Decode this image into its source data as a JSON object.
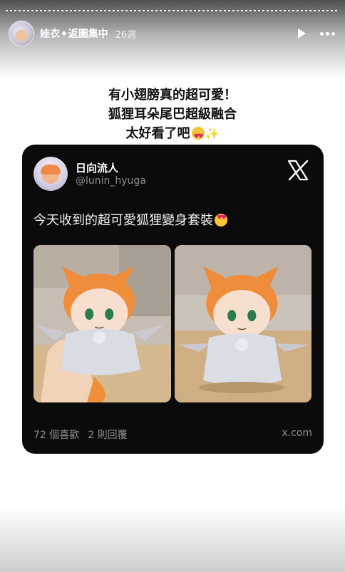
{
  "story": {
    "account_name": "娃衣✦返圖集中",
    "age": "26週"
  },
  "caption": {
    "line1": "有小翅膀真的超可愛！",
    "line2": "狐狸耳朵尾巴超級融合",
    "line3": "太好看了吧"
  },
  "post": {
    "display_name": "日向流人",
    "handle": "@lunin_hyuga",
    "text": "今天收到的超可愛狐狸變身套裝",
    "likes": "72 個喜歡",
    "replies": "2 則回覆",
    "source": "x.com"
  },
  "icons": {
    "play": "play-icon",
    "more": "more-icon",
    "x_logo": "x-logo-icon"
  },
  "colors": {
    "card_bg": "#0b0b0b",
    "muted_text": "#8e8e8e",
    "plush_hair": "#f0913e"
  }
}
